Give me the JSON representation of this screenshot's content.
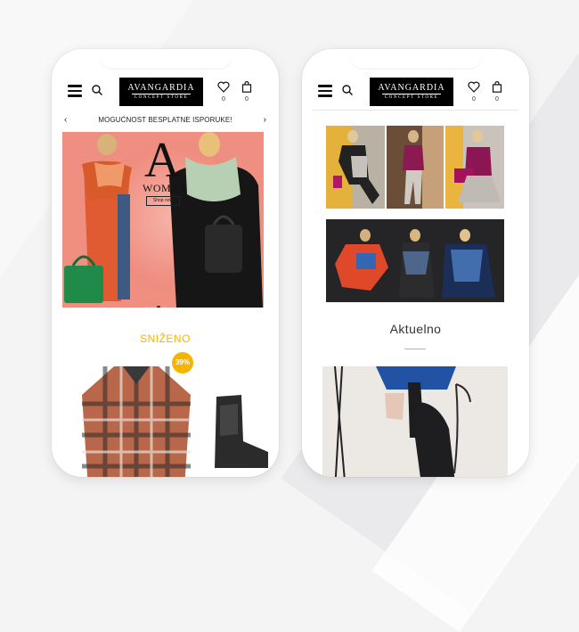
{
  "store": {
    "name": "AVANGARDIA",
    "tagline": "CONCEPT STORE"
  },
  "header": {
    "wishlist_count": "0",
    "cart_count": "0"
  },
  "promo": {
    "text": "MOGUĆNOST BESPLATNE ISPORUKE!",
    "prev": "‹",
    "next": "›"
  },
  "hero": {
    "letter": "A",
    "title": "WOMAN",
    "cta": "Shop now",
    "slides": 4,
    "active_slide": 3
  },
  "sale": {
    "title": "SNIŽENO",
    "discount": "39%"
  },
  "section": {
    "title": "Aktuelno"
  },
  "colors": {
    "accent": "#f5b400",
    "logo_bg": "#000000",
    "hero_bg": "#ef8f82"
  },
  "icons": [
    "hamburger-menu-icon",
    "search-icon",
    "heart-icon",
    "shopping-bag-icon",
    "chevron-left-icon",
    "chevron-right-icon"
  ]
}
